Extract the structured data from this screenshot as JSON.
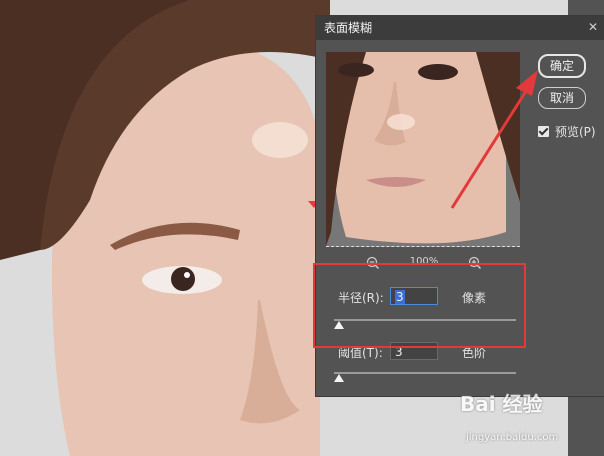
{
  "dialog": {
    "title": "表面模糊",
    "ok_label": "确定",
    "cancel_label": "取消",
    "preview_label": "预览(P)",
    "preview_checked": true,
    "zoom_level": "100%",
    "radius": {
      "label": "半径(R):",
      "value": "3",
      "unit": "像素",
      "slider_fraction": 0.03
    },
    "threshold": {
      "label": "阈值(T):",
      "value": "3",
      "unit": "色阶",
      "slider_fraction": 0.03
    }
  },
  "watermark": {
    "text": "Bai 经验",
    "url": "jingyan.baidu.com"
  },
  "colors": {
    "highlight": "#e23a3a",
    "dialog_bg": "#535353",
    "titlebar": "#3c3c3c"
  }
}
